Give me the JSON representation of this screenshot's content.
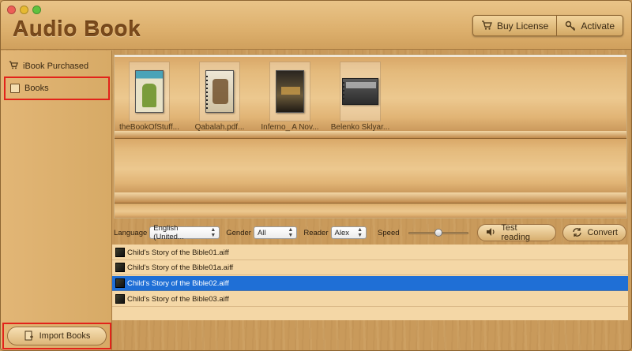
{
  "window": {
    "title": "Audio Book"
  },
  "header": {
    "buy_license_label": "Buy License",
    "activate_label": "Activate"
  },
  "sidebar": {
    "items": [
      {
        "label": "iBook Purchased",
        "icon": "cart-icon"
      },
      {
        "label": "Books",
        "icon": "book-icon",
        "highlighted": true
      }
    ],
    "import_label": "Import Books"
  },
  "shelf": {
    "books": [
      {
        "label": "theBookOfStuff...",
        "icon": "book-cover-icon"
      },
      {
        "label": "Qabalah.pdf...",
        "icon": "book-cover-icon"
      },
      {
        "label": "Inferno_ A Nov...",
        "icon": "book-cover-icon"
      },
      {
        "label": "Belenko Sklyar...",
        "icon": "book-cover-icon"
      }
    ]
  },
  "controls": {
    "language_label": "Language",
    "language_value": "English (United...",
    "gender_label": "Gender",
    "gender_value": "All",
    "reader_label": "Reader",
    "reader_value": "Alex",
    "speed_label": "Speed",
    "speed_level": 0.5,
    "test_label": "Test reading",
    "convert_label": "Convert"
  },
  "files": [
    {
      "name": "Child's Story of the Bible01.aiff",
      "selected": false
    },
    {
      "name": "Child's Story of the Bible01a.aiff",
      "selected": false
    },
    {
      "name": "Child's Story of the Bible02.aiff",
      "selected": true
    },
    {
      "name": "Child's Story of the Bible03.aiff",
      "selected": false
    }
  ],
  "colors": {
    "highlight_border": "#e2231a",
    "selection_blue": "#1f6fd6",
    "wood": "#d6a865"
  }
}
